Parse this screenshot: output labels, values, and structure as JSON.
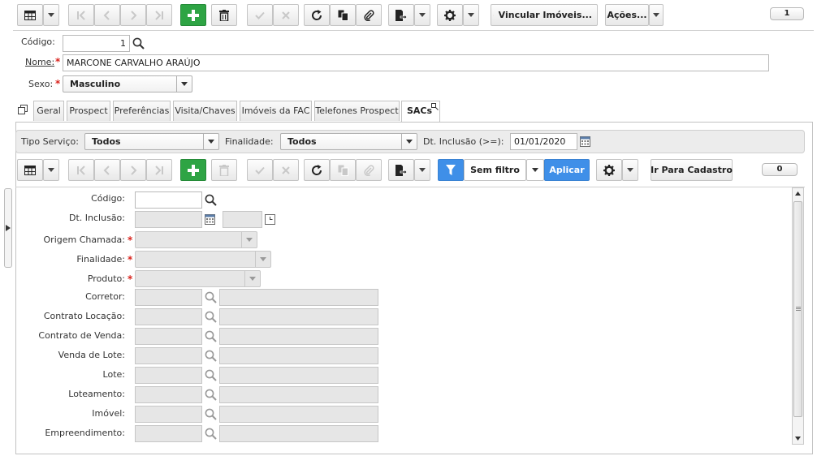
{
  "toolbar": {
    "buttons": {
      "vincular_label": "Vincular Imóveis...",
      "acoes_label": "Ações..."
    },
    "record_count": "1"
  },
  "header_form": {
    "codigo_label": "Código:",
    "codigo_value": "1",
    "nome_label": "Nome:",
    "nome_value": "MARCONE CARVALHO ARAÚJO",
    "sexo_label": "Sexo:",
    "sexo_value": "Masculino"
  },
  "tabs": [
    {
      "label": "Geral"
    },
    {
      "label": "Prospect"
    },
    {
      "label": "Preferências"
    },
    {
      "label": "Visita/Chaves"
    },
    {
      "label": "Imóveis da FAC"
    },
    {
      "label": "Telefones Prospect"
    },
    {
      "label": "SACs"
    }
  ],
  "filters": {
    "tipo_servico_label": "Tipo Serviço:",
    "tipo_servico_value": "Todos",
    "finalidade_label": "Finalidade:",
    "finalidade_value": "Todos",
    "dt_inclusao_label": "Dt. Inclusão (>=):",
    "dt_inclusao_value": "01/01/2020"
  },
  "inner_toolbar": {
    "sem_filtro_label": "Sem filtro",
    "aplicar_label": "Aplicar",
    "ir_para_label": "Ir Para Cadastro",
    "record_count": "0"
  },
  "sac_form": {
    "codigo_label": "Código:",
    "dt_inclusao_label": "Dt. Inclusão:",
    "origem_label": "Origem Chamada:",
    "finalidade_label": "Finalidade:",
    "produto_label": "Produto:",
    "corretor_label": "Corretor:",
    "contrato_locacao_label": "Contrato Locação:",
    "contrato_venda_label": "Contrato de Venda:",
    "venda_lote_label": "Venda de Lote:",
    "lote_label": "Lote:",
    "loteamento_label": "Loteamento:",
    "imovel_label": "Imóvel:",
    "empreendimento_label": "Empreendimento:"
  },
  "colors": {
    "primary_green": "#2ea444",
    "filter_blue": "#3f8fe8",
    "required_red": "#d9231d"
  }
}
